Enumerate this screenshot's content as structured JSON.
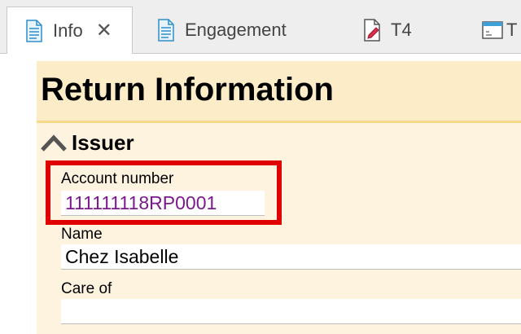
{
  "tabs": [
    {
      "label": "Info",
      "icon": "document-icon",
      "active": true,
      "closable": true
    },
    {
      "label": "Engagement",
      "icon": "document-icon",
      "active": false
    },
    {
      "label": "T4",
      "icon": "form-pencil-icon",
      "active": false
    },
    {
      "label": "T",
      "icon": "form-window-icon",
      "active": false
    }
  ],
  "close_symbol": "✕",
  "page": {
    "title": "Return Information"
  },
  "section": {
    "label": "Issuer",
    "expanded": true
  },
  "fields": {
    "account_number": {
      "label": "Account number",
      "value": "111111118RP0001"
    },
    "name": {
      "label": "Name",
      "value": "Chez Isabelle"
    },
    "care_of": {
      "label": "Care of",
      "value": ""
    }
  },
  "colors": {
    "panel_bg": "#fdf3df",
    "title_bg": "#fdecc8",
    "highlight": "#e00000",
    "account_value": "#7a1a8c"
  }
}
